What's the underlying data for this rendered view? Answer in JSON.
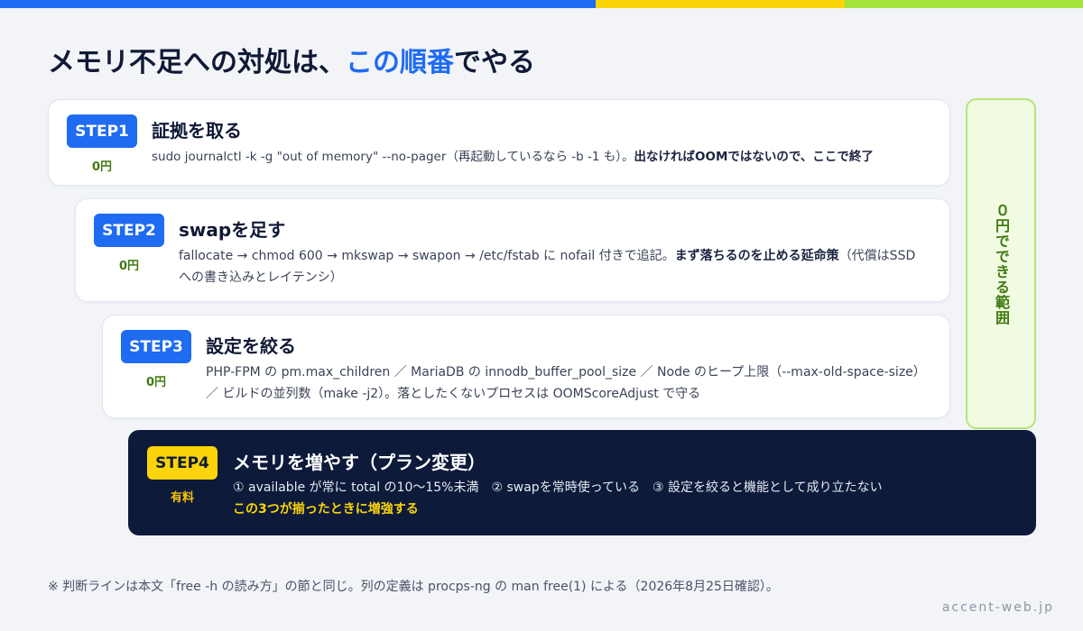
{
  "title": {
    "main": "メモリ不足への対処は、",
    "highlight": "この順番",
    "suffix": "でやる"
  },
  "steps": [
    {
      "badge": "STEP1",
      "cost": "0円",
      "title": "証拠を取る",
      "desc": "sudo journalctl -k -g \"out of memory\" --no-pager（再起動しているなら -b -1 も）。",
      "desc_bold": "出なければOOMではないので、ここで終了",
      "desc_tail": ""
    },
    {
      "badge": "STEP2",
      "cost": "0円",
      "title": "swapを足す",
      "desc": "fallocate → chmod 600 → mkswap → swapon → /etc/fstab に nofail 付きで追記。",
      "desc_bold": "まず落ちるのを止める延命策",
      "desc_tail": "（代償はSSDへの書き込みとレイテンシ）"
    },
    {
      "badge": "STEP3",
      "cost": "0円",
      "title": "設定を絞る",
      "desc": "PHP-FPM の pm.max_children ／ MariaDB の innodb_buffer_pool_size ／ Node のヒープ上限（--max-old-space-size）／ ビルドの並列数（make -j2）。落としたくないプロセスは OOMScoreAdjust で守る",
      "desc_bold": "",
      "desc_tail": ""
    },
    {
      "badge": "STEP4",
      "cost": "有料",
      "title": "メモリを増やす（プラン変更）",
      "desc": "① available が常に total の10〜15%未満　② swapを常時使っている　③ 設定を絞ると機能として成り立たない",
      "desc_bold": "この3つが揃ったときに増強する",
      "desc_tail": ""
    }
  ],
  "side_label": "０円でできる範囲",
  "footnote": "※ 判断ラインは本文「free -h の読み方」の節と同じ。列の定義は procps-ng の man free(1) による（2026年8月25日確認）。",
  "site": "accent-web.jp",
  "colors": {
    "accent_blue": "#1f6bf2",
    "accent_yellow": "#fbd40a",
    "accent_green": "#a5e23b",
    "dark_navy": "#0d1a3a",
    "cost_green": "#3f7a12"
  }
}
